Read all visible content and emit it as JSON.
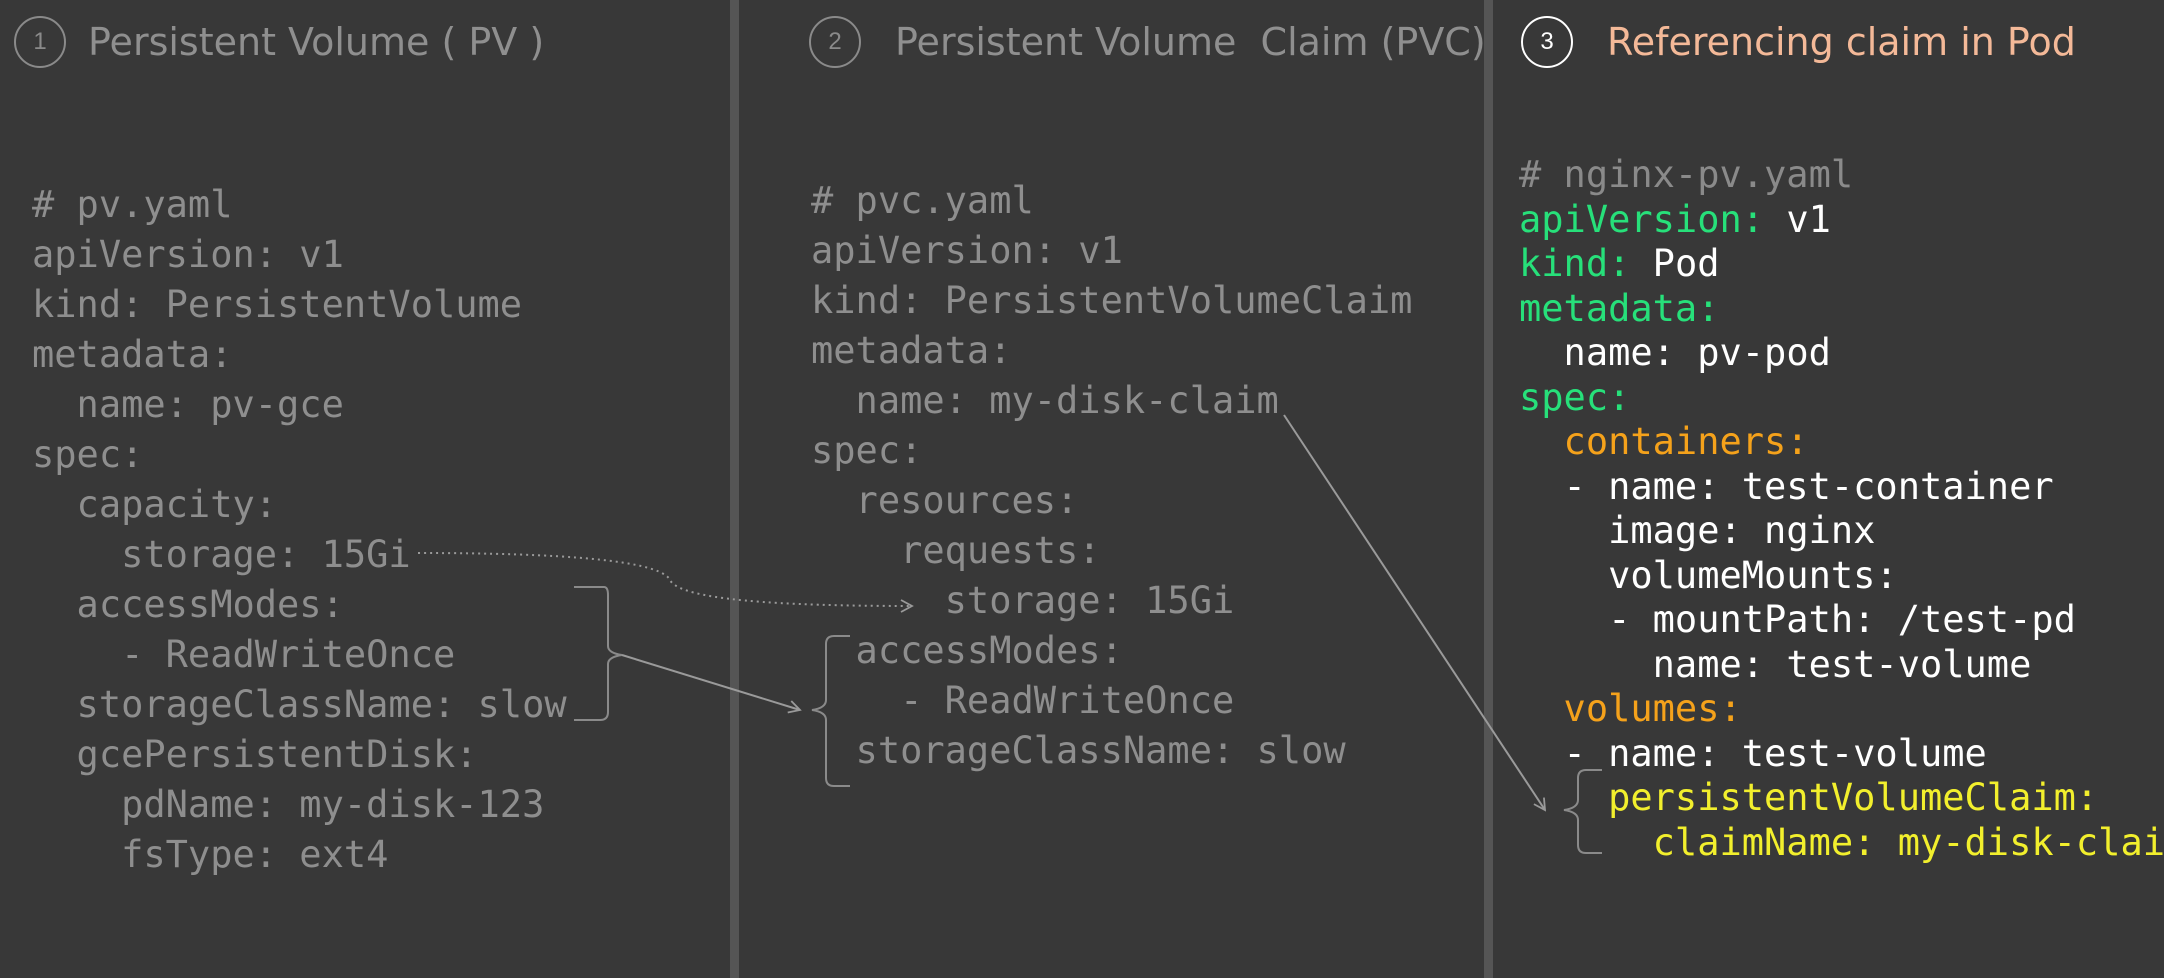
{
  "panels": [
    {
      "number": "1",
      "title": "Persistent Volume ( PV )",
      "lines": [
        "# pv.yaml",
        "apiVersion: v1",
        "kind: PersistentVolume",
        "metadata:",
        "  name: pv-gce",
        "spec:",
        "  capacity:",
        "    storage: 15Gi",
        "  accessModes:",
        "    - ReadWriteOnce",
        "  storageClassName: slow",
        "  gcePersistentDisk:",
        "    pdName: my-disk-123",
        "    fsType: ext4"
      ]
    },
    {
      "number": "2",
      "title": "Persistent Volume  Claim (PVC)",
      "lines": [
        "# pvc.yaml",
        "apiVersion: v1",
        "kind: PersistentVolumeClaim",
        "metadata:",
        "  name: my-disk-claim",
        "spec:",
        "  resources:",
        "    requests:",
        "      storage: 15Gi",
        "  accessModes:",
        "    - ReadWriteOnce",
        "  storageClassName: slow"
      ]
    },
    {
      "number": "3",
      "title": "Referencing claim in Pod",
      "lines": [
        {
          "key": "# nginx-pv.yaml",
          "val": ""
        },
        {
          "key": "apiVersion:",
          "val": " v1"
        },
        {
          "key": "kind:",
          "val": " Pod"
        },
        {
          "key": "metadata:",
          "val": ""
        },
        {
          "key": "  name:",
          "val": " pv-pod"
        },
        {
          "key": "spec:",
          "val": ""
        },
        {
          "key": "  containers:",
          "val": ""
        },
        {
          "key": "  - name:",
          "val": " test-container"
        },
        {
          "key": "    image:",
          "val": " nginx"
        },
        {
          "key": "    volumeMounts:",
          "val": ""
        },
        {
          "key": "    - mountPath:",
          "val": " /test-pd"
        },
        {
          "key": "      name:",
          "val": " test-volume"
        },
        {
          "key": "  volumes:",
          "val": ""
        },
        {
          "key": "  - name:",
          "val": " test-volume"
        },
        {
          "key": "    persistentVolumeClaim:",
          "val": ""
        },
        {
          "key": "      claimName: my-disk-claim",
          "val": ""
        }
      ]
    }
  ],
  "colors": {
    "background": "#383838",
    "dimmed_text": "#8e8e8e",
    "top_level_key": "#27e07a",
    "list_key": "#f5a21b",
    "claim_key": "#f2ef2d",
    "value": "#ffffff",
    "title_active": "#f4b998"
  }
}
